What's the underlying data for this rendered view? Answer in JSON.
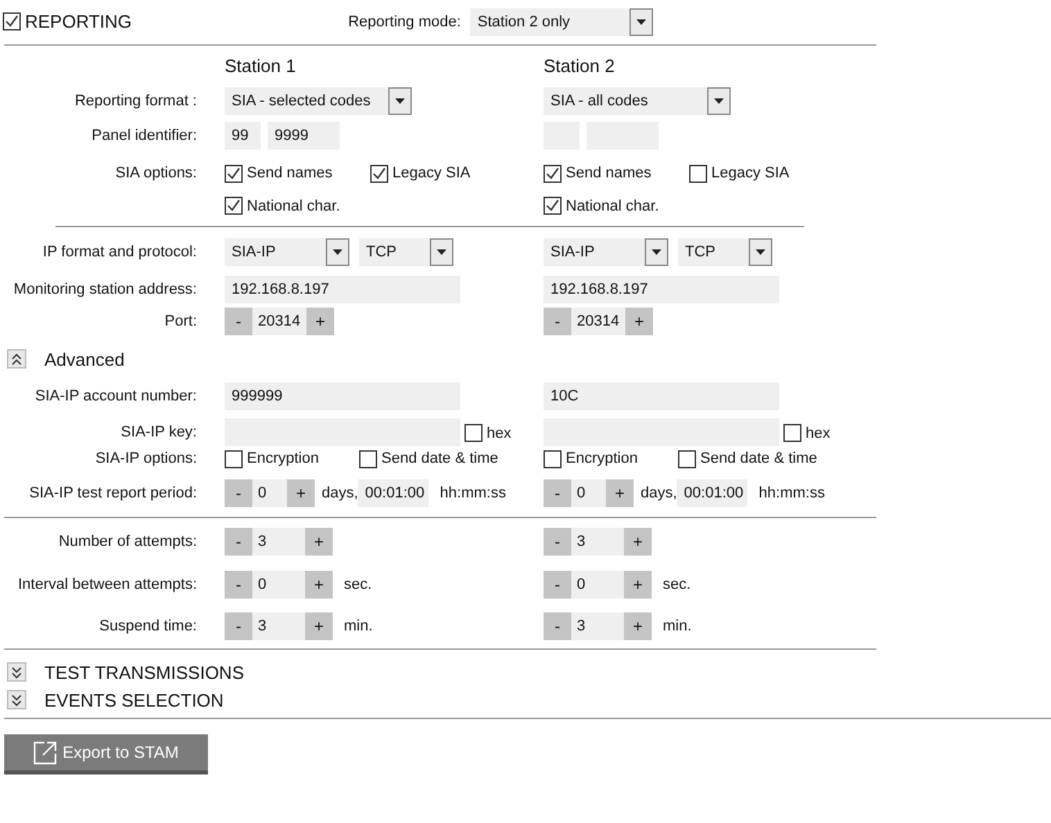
{
  "reporting": {
    "label": "REPORTING",
    "checked": true
  },
  "mode": {
    "label": "Reporting mode:",
    "value": "Station 2 only"
  },
  "labels": {
    "format": "Reporting format :",
    "panel_id": "Panel identifier:",
    "sia_options": "SIA options:",
    "ip": "IP format and protocol:",
    "address": "Monitoring station address:",
    "port": "Port:",
    "account": "SIA-IP account number:",
    "key": "SIA-IP key:",
    "ip_options": "SIA-IP options:",
    "test_period": "SIA-IP test report period:",
    "attempts": "Number of attempts:",
    "interval": "Interval between attempts:",
    "suspend": "Suspend time:"
  },
  "advanced": {
    "label": "Advanced",
    "expanded": true
  },
  "stations": [
    {
      "header": "Station 1",
      "format": "SIA - selected codes",
      "panel_id": [
        "99",
        "9999"
      ],
      "sia_options": [
        {
          "label": "Send names",
          "checked": true
        },
        {
          "label": "Legacy SIA",
          "checked": true
        },
        {
          "label": "National char.",
          "checked": true
        }
      ],
      "ip_format": "SIA-IP",
      "protocol": "TCP",
      "address": "192.168.8.197",
      "port": {
        "minus": "-",
        "value": "20314",
        "plus": "+"
      },
      "account": "999999",
      "hex": {
        "label": "hex",
        "checked": false
      },
      "ip_options": [
        {
          "label": "Encryption",
          "checked": false
        },
        {
          "label": "Send date & time",
          "checked": false
        }
      ],
      "test_period": {
        "minus": "-",
        "value": "0",
        "plus": "+",
        "unit": "days,",
        "time": "00:01:00",
        "time_unit": "hh:mm:ss"
      },
      "attempts": {
        "minus": "-",
        "value": "3",
        "plus": "+"
      },
      "interval": {
        "minus": "-",
        "value": "0",
        "plus": "+",
        "unit": "sec."
      },
      "suspend": {
        "minus": "-",
        "value": "3",
        "plus": "+",
        "unit": "min."
      }
    },
    {
      "header": "Station 2",
      "format": "SIA - all codes",
      "sia_options": [
        {
          "label": "Send names",
          "checked": true
        },
        {
          "label": "Legacy SIA",
          "checked": false
        },
        {
          "label": "National char.",
          "checked": true
        }
      ],
      "ip_format": "SIA-IP",
      "protocol": "TCP",
      "address": "192.168.8.197",
      "port": {
        "minus": "-",
        "value": "20314",
        "plus": "+"
      },
      "account": "10C",
      "hex": {
        "label": "hex",
        "checked": false
      },
      "ip_options": [
        {
          "label": "Encryption",
          "checked": false
        },
        {
          "label": "Send date & time",
          "checked": false
        }
      ],
      "test_period": {
        "minus": "-",
        "value": "0",
        "plus": "+",
        "unit": "days,",
        "time": "00:01:00",
        "time_unit": "hh:mm:ss"
      },
      "attempts": {
        "minus": "-",
        "value": "3",
        "plus": "+"
      },
      "interval": {
        "minus": "-",
        "value": "0",
        "plus": "+",
        "unit": "sec."
      },
      "suspend": {
        "minus": "-",
        "value": "3",
        "plus": "+",
        "unit": "min."
      }
    }
  ],
  "sections": [
    {
      "label": "TEST TRANSMISSIONS",
      "expanded": false
    },
    {
      "label": "EVENTS SELECTION",
      "expanded": false
    }
  ],
  "export_button": "Export to STAM"
}
